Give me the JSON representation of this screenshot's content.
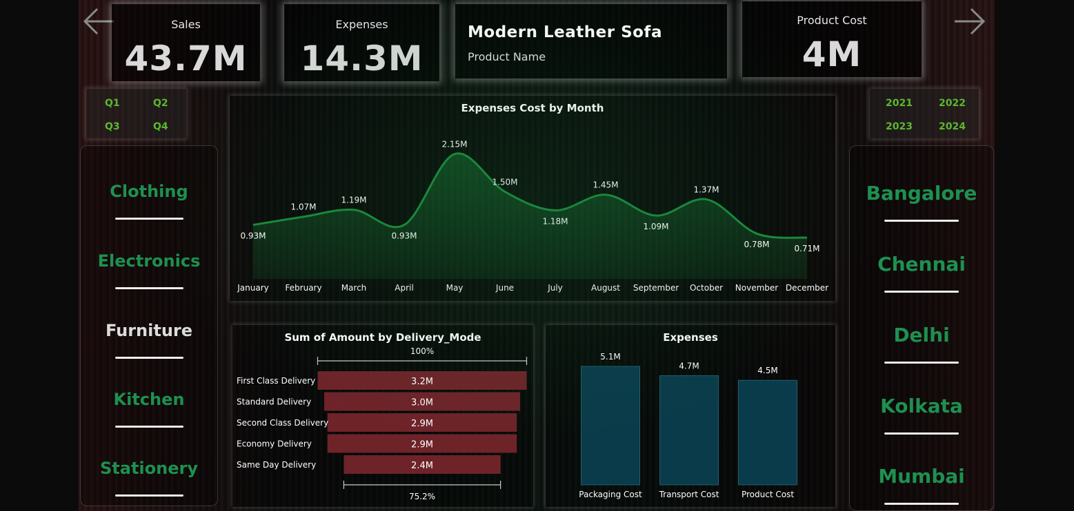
{
  "kpis": {
    "sales": {
      "label": "Sales",
      "value": "43.7M"
    },
    "expenses": {
      "label": "Expenses",
      "value": "14.3M"
    },
    "product_cost": {
      "label": "Product Cost",
      "value": "4M"
    }
  },
  "product": {
    "name": "Modern Leather Sofa",
    "label": "Product Name"
  },
  "nav": {
    "back_icon": "arrow-left-icon",
    "forward_icon": "arrow-right-icon"
  },
  "quarters": [
    "Q1",
    "Q2",
    "Q3",
    "Q4"
  ],
  "years": [
    "2021",
    "2022",
    "2023",
    "2024"
  ],
  "categories": [
    "Clothing",
    "Electronics",
    "Furniture",
    "Kitchen",
    "Stationery"
  ],
  "selected_category": "Furniture",
  "cities": [
    "Bangalore",
    "Chennai",
    "Delhi",
    "Kolkata",
    "Mumbai"
  ],
  "colors": {
    "accent_green": "#1d9150",
    "slicer_green": "#5cb82e",
    "bar_red": "#6e2329",
    "bar_teal": "#0a3b4a",
    "line_green": "#1a8a3c"
  },
  "chart_data": [
    {
      "type": "area",
      "title": "Expenses Cost by Month",
      "categories": [
        "January",
        "February",
        "March",
        "April",
        "May",
        "June",
        "July",
        "August",
        "September",
        "October",
        "November",
        "December"
      ],
      "values": [
        0.93,
        1.07,
        1.19,
        0.93,
        2.15,
        1.5,
        1.18,
        1.45,
        1.09,
        1.37,
        0.78,
        0.71
      ],
      "data_labels": [
        "0.93M",
        "1.07M",
        "1.19M",
        "0.93M",
        "2.15M",
        "1.50M",
        "1.18M",
        "1.45M",
        "1.09M",
        "1.37M",
        "0.78M",
        "0.71M"
      ],
      "ylim": [
        0,
        2.3
      ]
    },
    {
      "type": "funnel",
      "title": "Sum of Amount by Delivery_Mode",
      "categories": [
        "First Class Delivery",
        "Standard Delivery",
        "Second Class Delivery",
        "Economy Delivery",
        "Same Day Delivery"
      ],
      "values": [
        3.2,
        3.0,
        2.9,
        2.9,
        2.4
      ],
      "data_labels": [
        "3.2M",
        "3.0M",
        "2.9M",
        "2.9M",
        "2.4M"
      ],
      "top_percent": "100%",
      "bottom_percent": "75.2%"
    },
    {
      "type": "bar",
      "title": "Expenses",
      "categories": [
        "Packaging Cost",
        "Transport Cost",
        "Product Cost"
      ],
      "values": [
        5.1,
        4.7,
        4.5
      ],
      "data_labels": [
        "5.1M",
        "4.7M",
        "4.5M"
      ]
    }
  ]
}
